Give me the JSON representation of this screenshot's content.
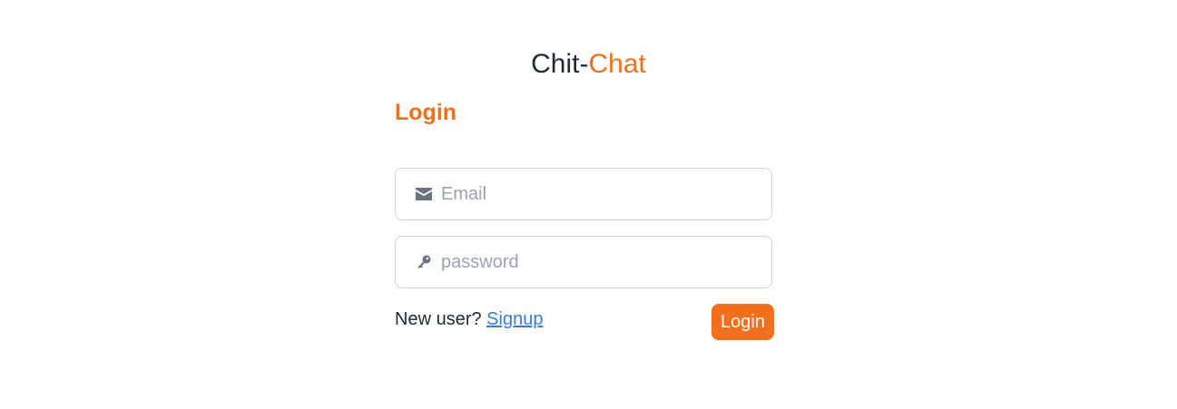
{
  "app": {
    "title_part1": "Chit-",
    "title_part2": "Chat",
    "accent_color": "#f26f1b"
  },
  "login_form": {
    "heading": "Login",
    "email": {
      "icon": "envelope-icon",
      "placeholder": "Email",
      "value": ""
    },
    "password": {
      "icon": "key-icon",
      "placeholder": "password",
      "value": ""
    },
    "new_user_prompt": "New user?",
    "signup_link": "Signup",
    "submit_label": "Login",
    "link_color": "#3b7bdc"
  }
}
